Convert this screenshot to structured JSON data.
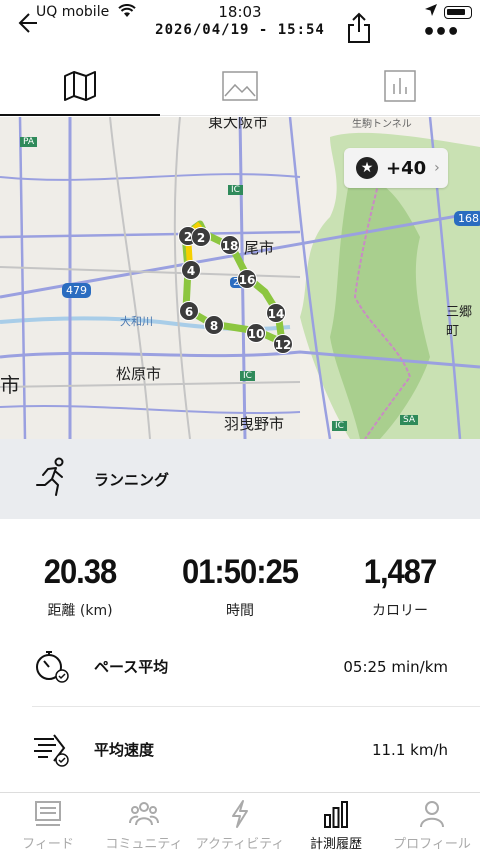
{
  "status": {
    "carrier": "UQ mobile",
    "time": "18:03"
  },
  "header": {
    "date_range": "2026/04/19 - 15:54"
  },
  "tabs": [
    {
      "icon": "map-icon",
      "active": true
    },
    {
      "icon": "image-icon",
      "active": false
    },
    {
      "icon": "chart-icon",
      "active": false
    }
  ],
  "map": {
    "labels": {
      "higashi_osaka": "東大阪市",
      "yao": "尾市",
      "matsubara": "松原市",
      "habikino": "羽曳野市",
      "misato": "三郷町",
      "ichi": "市",
      "yamato_river": "大和川",
      "tunnel": "生駒トンネル",
      "route_479": "479",
      "route_168": "168",
      "ic": "IC",
      "pa": "PA",
      "sa": "SA",
      "r25": "25"
    },
    "km_markers": [
      "2",
      "2",
      "18",
      "4",
      "16",
      "6",
      "14",
      "8",
      "10",
      "12"
    ],
    "badge": {
      "count": "+40"
    }
  },
  "activity": {
    "type": "ランニング"
  },
  "stats": [
    {
      "value": "20.38",
      "label": "距離 (km)"
    },
    {
      "value": "01:50:25",
      "label": "時間"
    },
    {
      "value": "1,487",
      "label": "カロリー"
    }
  ],
  "details": [
    {
      "label": "ペース平均",
      "value": "05:25 min/km"
    },
    {
      "label": "平均速度",
      "value": "11.1 km/h"
    }
  ],
  "nav": [
    {
      "label": "フィード",
      "active": false
    },
    {
      "label": "コミュニティ",
      "active": false
    },
    {
      "label": "アクティビティ",
      "active": false
    },
    {
      "label": "計測履歴",
      "active": true
    },
    {
      "label": "プロフィール",
      "active": false
    }
  ],
  "colors": {
    "route": "#8cc63f",
    "route_highlight": "#f5d000",
    "forest": "#b9d8a0",
    "road_blue": "#8a90d8",
    "activity_bg": "#eaecef"
  }
}
